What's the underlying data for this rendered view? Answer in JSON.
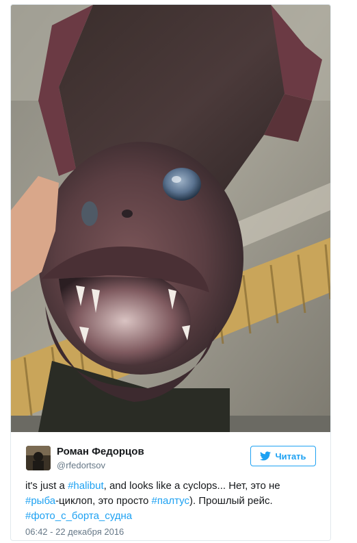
{
  "author": {
    "name": "Роман Федорцов",
    "handle": "@rfedortsov"
  },
  "follow_button": {
    "label": "Читать",
    "icon": "twitter-bird-icon"
  },
  "tweet": {
    "line1": {
      "part1": "it's just a ",
      "hashtag1": "#halibut",
      "part2": ", and looks like a cyclops... Нет, это не"
    },
    "line2": {
      "hashtag2": "#рыба",
      "part3": "-циклоп, это просто ",
      "hashtag3": "#палтус",
      "part4": "). Прошлый рейс."
    },
    "line3": {
      "hashtag4": "#фото_с_борта_судна"
    }
  },
  "timestamp": "06:42 - 22 декабря 2016",
  "colors": {
    "link": "#1da1f2",
    "text": "#14171a",
    "muted": "#657786",
    "border": "#e1e8ed"
  }
}
